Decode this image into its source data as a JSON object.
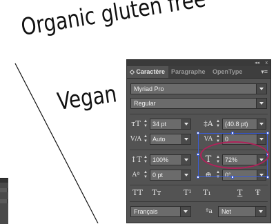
{
  "canvas": {
    "headline_text": "Organic gluten free",
    "subline_text": "Vegan"
  },
  "panel": {
    "collapse_arrows": "◂◂",
    "close_mark": "x",
    "tabs": [
      {
        "label": "◇ Caractère",
        "active": true
      },
      {
        "label": "Paragraphe",
        "active": false
      },
      {
        "label": "OpenType",
        "active": false
      }
    ],
    "menu_icon": "▾≡",
    "font_family": "Myriad Pro",
    "font_style": "Regular",
    "font_size": "34 pt",
    "leading": "(40.8 pt)",
    "kerning": "Auto",
    "tracking": "0",
    "vertical_scale": "100%",
    "horizontal_scale": "72%",
    "baseline_shift": "0 pt",
    "rotation": "0°",
    "text_buttons": [
      "TT",
      "Tт",
      "T¹",
      "T₁",
      "T",
      "Ŧ"
    ],
    "language": "Français",
    "antialias_icon_label": "ªa",
    "antialias": "Net"
  },
  "colors": {
    "panel_bg": "#535353",
    "selection": "#3a5cd6",
    "annotation": "#b0225a"
  }
}
